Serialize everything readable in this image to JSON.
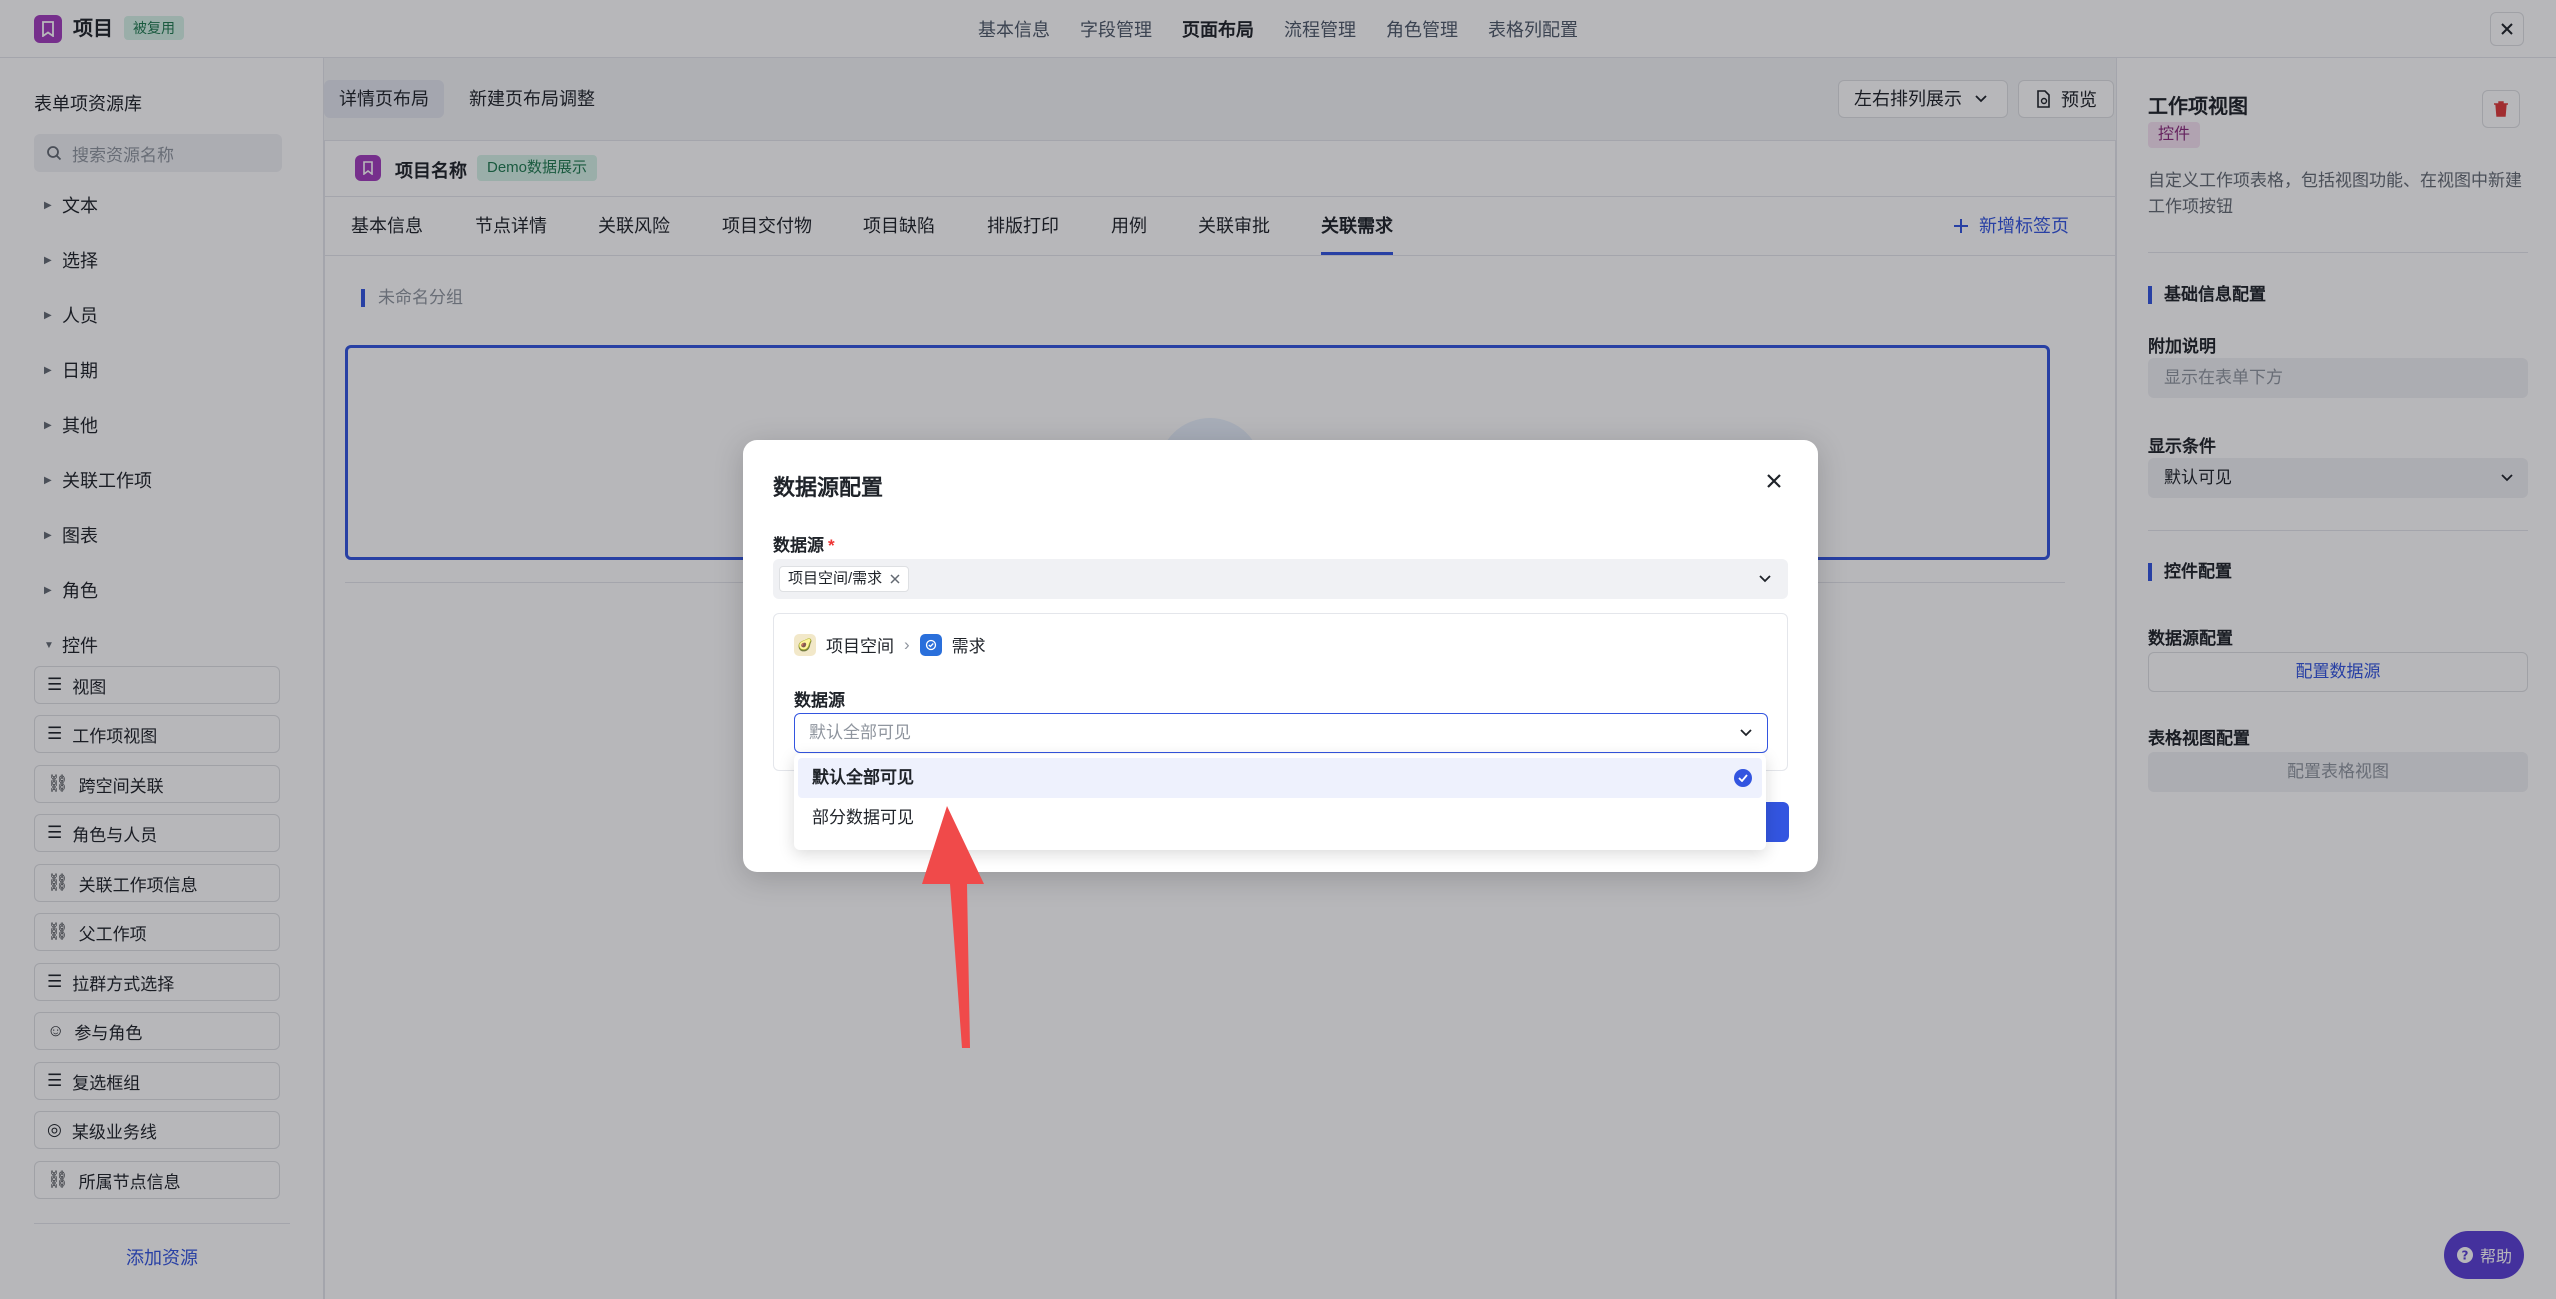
{
  "topbar": {
    "title": "项目",
    "badge": "被复用",
    "nav": [
      "基本信息",
      "字段管理",
      "页面布局",
      "流程管理",
      "角色管理",
      "表格列配置"
    ],
    "active_nav": "页面布局"
  },
  "left_panel": {
    "title": "表单项资源库",
    "search_placeholder": "搜索资源名称",
    "categories": [
      "文本",
      "选择",
      "人员",
      "日期",
      "其他",
      "关联工作项",
      "图表",
      "角色"
    ],
    "expanded_category": "控件",
    "controls": [
      "视图",
      "工作项视图",
      "跨空间关联",
      "角色与人员",
      "关联工作项信息",
      "父工作项",
      "拉群方式选择",
      "参与角色",
      "复选框组",
      "某级业务线",
      "所属节点信息"
    ],
    "add_resource": "添加资源"
  },
  "center": {
    "layout_tabs": [
      "详情页布局",
      "新建页布局调整"
    ],
    "layout_select": "左右排列展示",
    "preview": "预览",
    "project_name": "项目名称",
    "demo_badge": "Demo数据展示",
    "sub_tabs": [
      "基本信息",
      "节点详情",
      "关联风险",
      "项目交付物",
      "项目缺陷",
      "排版打印",
      "用例",
      "关联审批",
      "关联需求"
    ],
    "active_sub_tab": "关联需求",
    "new_tab": "新增标签页",
    "group_name": "未命名分组"
  },
  "right_panel": {
    "title": "工作项视图",
    "badge": "控件",
    "description": "自定义工作项表格，包括视图功能、在视图中新建工作项按钮",
    "basic_section": "基础信息配置",
    "extra_label": "附加说明",
    "extra_placeholder": "显示在表单下方",
    "condition_label": "显示条件",
    "condition_value": "默认可见",
    "control_section": "控件配置",
    "ds_config_label": "数据源配置",
    "ds_config_button": "配置数据源",
    "table_view_label": "表格视图配置",
    "table_view_button": "配置表格视图"
  },
  "help": "帮助",
  "modal": {
    "title": "数据源配置",
    "ds_label": "数据源",
    "required_mark": "*",
    "selected_tag": "项目空间/需求",
    "path_space": "项目空间",
    "path_item": "需求",
    "inner_label": "数据源",
    "inner_placeholder": "默认全部可见",
    "options": [
      "默认全部可见",
      "部分数据可见"
    ],
    "selected_option": "默认全部可见"
  },
  "colors": {
    "accent": "#3355e0",
    "brand_purple": "#a23dbd",
    "annotation_arrow": "#f04a4a"
  }
}
